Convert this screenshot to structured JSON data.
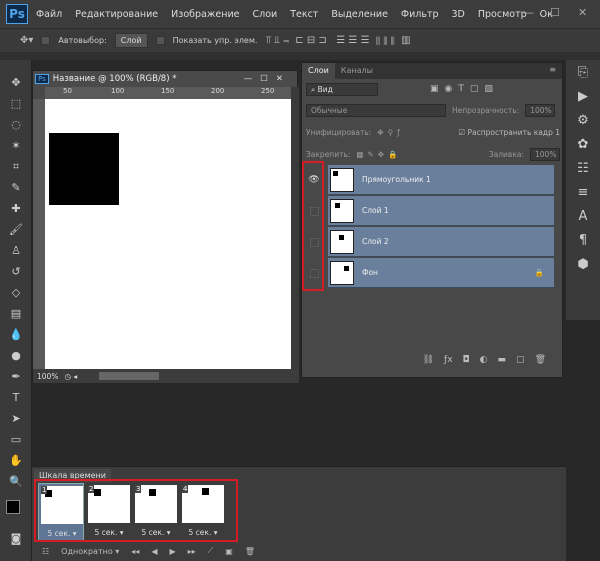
{
  "app": {
    "logo": "Ps",
    "menu": [
      "Файл",
      "Редактирование",
      "Изображение",
      "Слои",
      "Текст",
      "Выделение",
      "Фильтр",
      "3D",
      "Просмотр",
      "Ок"
    ],
    "window_controls": [
      "—",
      "☐",
      "✕"
    ]
  },
  "options": {
    "autoselect_label": "Автовыбор:",
    "autoselect_value": "Слой",
    "show_transform_label": "Показать упр. элем."
  },
  "document": {
    "title": "Название @ 100% (RGB/8) *",
    "ruler_ticks": [
      "50",
      "100",
      "150",
      "200",
      "250",
      "300"
    ],
    "zoom": "100%"
  },
  "layers_panel": {
    "tabs": [
      "Слои",
      "Каналы"
    ],
    "filter": "Вид",
    "blend_mode": "Обычные",
    "opacity_label": "Непрозрачность:",
    "opacity_value": "100%",
    "unify_label": "Унифицировать:",
    "propagate_label": "Распространить кадр 1",
    "lock_label": "Закрепить:",
    "fill_label": "Заливка:",
    "fill_value": "100%",
    "layers": [
      {
        "name": "Прямоугольник 1",
        "visible": true
      },
      {
        "name": "Слой 1",
        "visible": false
      },
      {
        "name": "Слой 2",
        "visible": false
      },
      {
        "name": "Фон",
        "visible": false,
        "locked": true
      }
    ]
  },
  "timeline": {
    "title": "Шкала времени",
    "frames": [
      {
        "num": "1",
        "duration": "5 сек."
      },
      {
        "num": "2",
        "duration": "5 сек."
      },
      {
        "num": "3",
        "duration": "5 сек."
      },
      {
        "num": "4",
        "duration": "5 сек."
      }
    ],
    "loop": "Однократно"
  },
  "colors": {
    "highlight": "#d41c24",
    "layer_selected": "#6a7f9c",
    "panel": "#484848"
  }
}
